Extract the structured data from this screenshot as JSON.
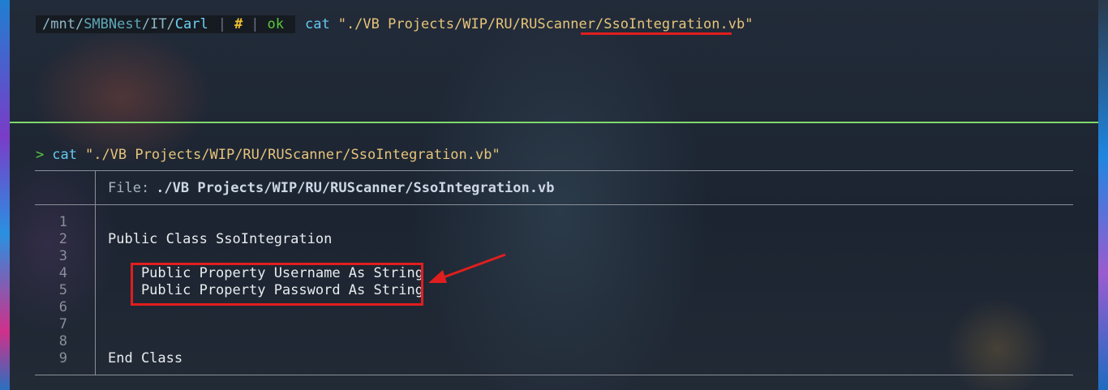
{
  "prompt": {
    "path_parts": [
      "/mnt/",
      "SMBNest",
      "/IT/",
      "Carl"
    ],
    "pipe": "|",
    "privilege": "#",
    "status": "ok",
    "command": "cat",
    "argument": "\"./VB Projects/WIP/RU/RUScanner/",
    "argument_highlight": "SsoIntegration.vb",
    "argument_end": "\""
  },
  "second_prompt": {
    "marker": ">",
    "command": "cat",
    "argument": "\"./VB Projects/WIP/RU/RUScanner/SsoIntegration.vb\""
  },
  "file_view": {
    "file_label": "File:",
    "file_name": "./VB Projects/WIP/RU/RUScanner/SsoIntegration.vb",
    "line_numbers": [
      "1",
      "2",
      "3",
      "4",
      "5",
      "6",
      "7",
      "8",
      "9"
    ],
    "lines": [
      "",
      "Public Class SsoIntegration",
      "",
      "    Public Property Username As String",
      "    Public Property Password As String",
      "",
      "",
      "",
      "End Class"
    ]
  },
  "colors": {
    "highlight_red": "#e01e1e",
    "separator_green": "#7ed96a",
    "status_green": "#59c93b",
    "string_yellow": "#e6c47a"
  }
}
